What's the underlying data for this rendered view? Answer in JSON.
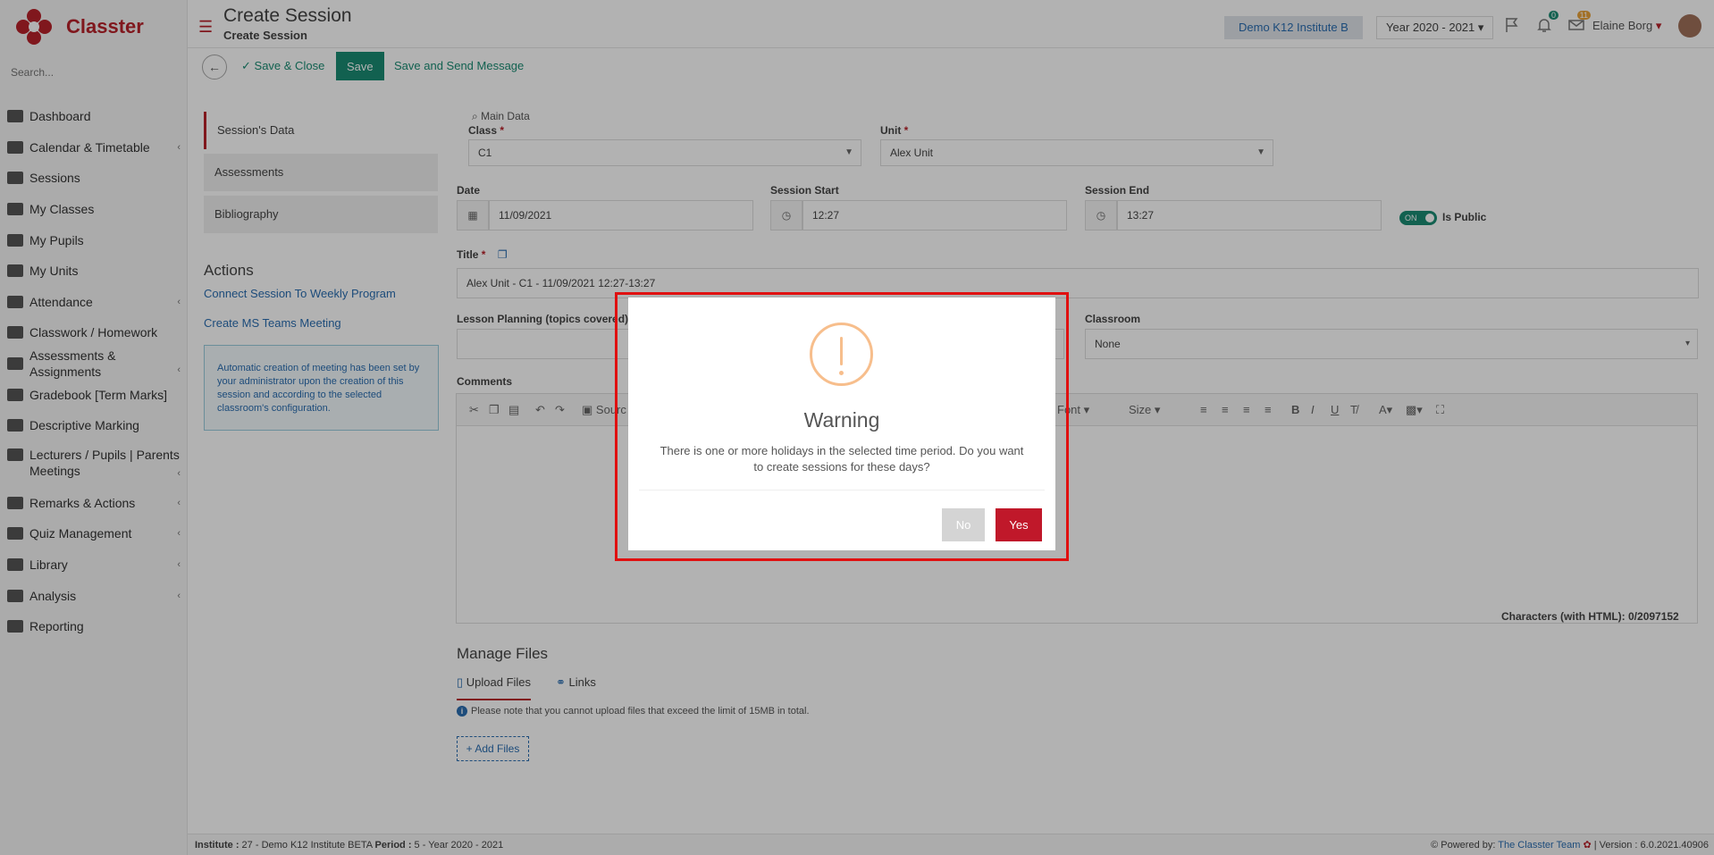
{
  "app": {
    "brand": "Classter"
  },
  "sidebar": {
    "search_placeholder": "Search...",
    "items": [
      {
        "label": "Dashboard",
        "icon": "laptop-icon",
        "chevron": false
      },
      {
        "label": "Calendar & Timetable",
        "icon": "calendar-icon",
        "chevron": true
      },
      {
        "label": "Sessions",
        "icon": "sessions-icon",
        "chevron": false
      },
      {
        "label": "My Classes",
        "icon": "classes-icon",
        "chevron": false
      },
      {
        "label": "My Pupils",
        "icon": "pupils-icon",
        "chevron": false
      },
      {
        "label": "My Units",
        "icon": "book-icon",
        "chevron": false
      },
      {
        "label": "Attendance",
        "icon": "attendance-icon",
        "chevron": true
      },
      {
        "label": "Classwork / Homework",
        "icon": "list-icon",
        "chevron": false
      },
      {
        "label": "Assessments & Assignments",
        "icon": "edit-icon",
        "chevron": true
      },
      {
        "label": "Gradebook [Term Marks]",
        "icon": "gradebook-icon",
        "chevron": false
      },
      {
        "label": "Descriptive Marking",
        "icon": "marking-icon",
        "chevron": false
      },
      {
        "label": "Lecturers / Pupils | Parents Meetings",
        "icon": "meetings-icon",
        "chevron": true
      },
      {
        "label": "Remarks & Actions",
        "icon": "shuffle-icon",
        "chevron": true
      },
      {
        "label": "Quiz Management",
        "icon": "quiz-icon",
        "chevron": true
      },
      {
        "label": "Library",
        "icon": "library-icon",
        "chevron": true
      },
      {
        "label": "Analysis",
        "icon": "chart-icon",
        "chevron": true
      },
      {
        "label": "Reporting",
        "icon": "print-icon",
        "chevron": false
      }
    ]
  },
  "header": {
    "title": "Create Session",
    "subtitle": "Create Session",
    "institute": "Demo K12 Institute B",
    "year": "Year 2020 - 2021",
    "notifications_count": "0",
    "messages_count": "11",
    "user_name": "Elaine Borg"
  },
  "toolbar": {
    "save_close": "Save & Close",
    "save": "Save",
    "save_send": "Save and Send Message"
  },
  "tabs": [
    "Session's Data",
    "Assessments",
    "Bibliography"
  ],
  "actions": {
    "title": "Actions",
    "connect": "Connect Session To Weekly Program",
    "teams": "Create MS Teams Meeting",
    "info": "Automatic creation of meeting has been set by your administrator upon the creation of this session and according to the selected classroom's configuration."
  },
  "form": {
    "section": "Main Data",
    "class_label": "Class",
    "class_value": "C1",
    "unit_label": "Unit",
    "unit_value": "Alex Unit",
    "date_label": "Date",
    "date_value": "11/09/2021",
    "start_label": "Session Start",
    "start_value": "12:27",
    "end_label": "Session End",
    "end_value": "13:27",
    "toggle_on": "ON",
    "is_public": "Is Public",
    "title_label": "Title",
    "title_value": "Alex Unit - C1 - 11/09/2021 12:27-13:27",
    "lesson_label": "Lesson Planning (topics covered)",
    "classroom_label": "Classroom",
    "classroom_value": "None",
    "comments_label": "Comments",
    "editor_source": "Sourc",
    "editor_font": "Font",
    "editor_size": "Size",
    "char_count": "Characters (with HTML): 0/2097152"
  },
  "files": {
    "title": "Manage Files",
    "tab_upload": "Upload Files",
    "tab_links": "Links",
    "note": "Please note that you cannot upload files that exceed the limit of 15MB in total.",
    "add": "Add Files"
  },
  "footer": {
    "institute_label": "Institute :",
    "institute_value": " 27 - Demo K12 Institute BETA ",
    "period_label": "Period :",
    "period_value": " 5 - Year 2020 - 2021",
    "powered": "Powered by:",
    "team": "The Classter Team",
    "version": "| Version : 6.0.2021.40906"
  },
  "modal": {
    "title": "Warning",
    "message": "There is one or more holidays in the selected time period. Do you want to create sessions for these days?",
    "no": "No",
    "yes": "Yes"
  }
}
